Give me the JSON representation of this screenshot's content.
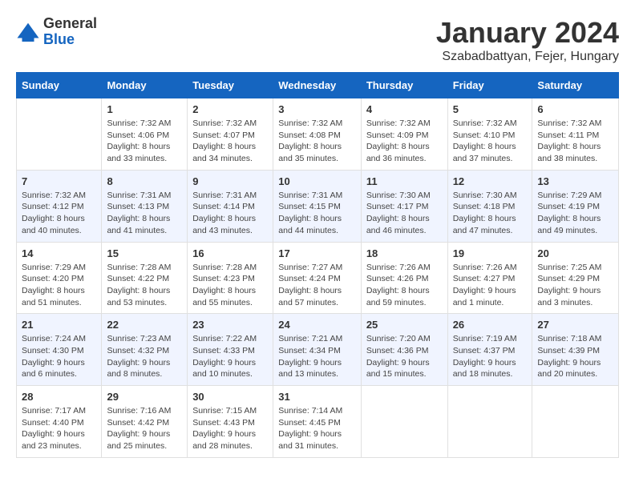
{
  "header": {
    "logo_general": "General",
    "logo_blue": "Blue",
    "month_title": "January 2024",
    "location": "Szabadbattyan, Fejer, Hungary"
  },
  "calendar": {
    "days_of_week": [
      "Sunday",
      "Monday",
      "Tuesday",
      "Wednesday",
      "Thursday",
      "Friday",
      "Saturday"
    ],
    "weeks": [
      [
        {
          "day": "",
          "sunrise": "",
          "sunset": "",
          "daylight": ""
        },
        {
          "day": "1",
          "sunrise": "Sunrise: 7:32 AM",
          "sunset": "Sunset: 4:06 PM",
          "daylight": "Daylight: 8 hours and 33 minutes."
        },
        {
          "day": "2",
          "sunrise": "Sunrise: 7:32 AM",
          "sunset": "Sunset: 4:07 PM",
          "daylight": "Daylight: 8 hours and 34 minutes."
        },
        {
          "day": "3",
          "sunrise": "Sunrise: 7:32 AM",
          "sunset": "Sunset: 4:08 PM",
          "daylight": "Daylight: 8 hours and 35 minutes."
        },
        {
          "day": "4",
          "sunrise": "Sunrise: 7:32 AM",
          "sunset": "Sunset: 4:09 PM",
          "daylight": "Daylight: 8 hours and 36 minutes."
        },
        {
          "day": "5",
          "sunrise": "Sunrise: 7:32 AM",
          "sunset": "Sunset: 4:10 PM",
          "daylight": "Daylight: 8 hours and 37 minutes."
        },
        {
          "day": "6",
          "sunrise": "Sunrise: 7:32 AM",
          "sunset": "Sunset: 4:11 PM",
          "daylight": "Daylight: 8 hours and 38 minutes."
        }
      ],
      [
        {
          "day": "7",
          "sunrise": "Sunrise: 7:32 AM",
          "sunset": "Sunset: 4:12 PM",
          "daylight": "Daylight: 8 hours and 40 minutes."
        },
        {
          "day": "8",
          "sunrise": "Sunrise: 7:31 AM",
          "sunset": "Sunset: 4:13 PM",
          "daylight": "Daylight: 8 hours and 41 minutes."
        },
        {
          "day": "9",
          "sunrise": "Sunrise: 7:31 AM",
          "sunset": "Sunset: 4:14 PM",
          "daylight": "Daylight: 8 hours and 43 minutes."
        },
        {
          "day": "10",
          "sunrise": "Sunrise: 7:31 AM",
          "sunset": "Sunset: 4:15 PM",
          "daylight": "Daylight: 8 hours and 44 minutes."
        },
        {
          "day": "11",
          "sunrise": "Sunrise: 7:30 AM",
          "sunset": "Sunset: 4:17 PM",
          "daylight": "Daylight: 8 hours and 46 minutes."
        },
        {
          "day": "12",
          "sunrise": "Sunrise: 7:30 AM",
          "sunset": "Sunset: 4:18 PM",
          "daylight": "Daylight: 8 hours and 47 minutes."
        },
        {
          "day": "13",
          "sunrise": "Sunrise: 7:29 AM",
          "sunset": "Sunset: 4:19 PM",
          "daylight": "Daylight: 8 hours and 49 minutes."
        }
      ],
      [
        {
          "day": "14",
          "sunrise": "Sunrise: 7:29 AM",
          "sunset": "Sunset: 4:20 PM",
          "daylight": "Daylight: 8 hours and 51 minutes."
        },
        {
          "day": "15",
          "sunrise": "Sunrise: 7:28 AM",
          "sunset": "Sunset: 4:22 PM",
          "daylight": "Daylight: 8 hours and 53 minutes."
        },
        {
          "day": "16",
          "sunrise": "Sunrise: 7:28 AM",
          "sunset": "Sunset: 4:23 PM",
          "daylight": "Daylight: 8 hours and 55 minutes."
        },
        {
          "day": "17",
          "sunrise": "Sunrise: 7:27 AM",
          "sunset": "Sunset: 4:24 PM",
          "daylight": "Daylight: 8 hours and 57 minutes."
        },
        {
          "day": "18",
          "sunrise": "Sunrise: 7:26 AM",
          "sunset": "Sunset: 4:26 PM",
          "daylight": "Daylight: 8 hours and 59 minutes."
        },
        {
          "day": "19",
          "sunrise": "Sunrise: 7:26 AM",
          "sunset": "Sunset: 4:27 PM",
          "daylight": "Daylight: 9 hours and 1 minute."
        },
        {
          "day": "20",
          "sunrise": "Sunrise: 7:25 AM",
          "sunset": "Sunset: 4:29 PM",
          "daylight": "Daylight: 9 hours and 3 minutes."
        }
      ],
      [
        {
          "day": "21",
          "sunrise": "Sunrise: 7:24 AM",
          "sunset": "Sunset: 4:30 PM",
          "daylight": "Daylight: 9 hours and 6 minutes."
        },
        {
          "day": "22",
          "sunrise": "Sunrise: 7:23 AM",
          "sunset": "Sunset: 4:32 PM",
          "daylight": "Daylight: 9 hours and 8 minutes."
        },
        {
          "day": "23",
          "sunrise": "Sunrise: 7:22 AM",
          "sunset": "Sunset: 4:33 PM",
          "daylight": "Daylight: 9 hours and 10 minutes."
        },
        {
          "day": "24",
          "sunrise": "Sunrise: 7:21 AM",
          "sunset": "Sunset: 4:34 PM",
          "daylight": "Daylight: 9 hours and 13 minutes."
        },
        {
          "day": "25",
          "sunrise": "Sunrise: 7:20 AM",
          "sunset": "Sunset: 4:36 PM",
          "daylight": "Daylight: 9 hours and 15 minutes."
        },
        {
          "day": "26",
          "sunrise": "Sunrise: 7:19 AM",
          "sunset": "Sunset: 4:37 PM",
          "daylight": "Daylight: 9 hours and 18 minutes."
        },
        {
          "day": "27",
          "sunrise": "Sunrise: 7:18 AM",
          "sunset": "Sunset: 4:39 PM",
          "daylight": "Daylight: 9 hours and 20 minutes."
        }
      ],
      [
        {
          "day": "28",
          "sunrise": "Sunrise: 7:17 AM",
          "sunset": "Sunset: 4:40 PM",
          "daylight": "Daylight: 9 hours and 23 minutes."
        },
        {
          "day": "29",
          "sunrise": "Sunrise: 7:16 AM",
          "sunset": "Sunset: 4:42 PM",
          "daylight": "Daylight: 9 hours and 25 minutes."
        },
        {
          "day": "30",
          "sunrise": "Sunrise: 7:15 AM",
          "sunset": "Sunset: 4:43 PM",
          "daylight": "Daylight: 9 hours and 28 minutes."
        },
        {
          "day": "31",
          "sunrise": "Sunrise: 7:14 AM",
          "sunset": "Sunset: 4:45 PM",
          "daylight": "Daylight: 9 hours and 31 minutes."
        },
        {
          "day": "",
          "sunrise": "",
          "sunset": "",
          "daylight": ""
        },
        {
          "day": "",
          "sunrise": "",
          "sunset": "",
          "daylight": ""
        },
        {
          "day": "",
          "sunrise": "",
          "sunset": "",
          "daylight": ""
        }
      ]
    ]
  }
}
